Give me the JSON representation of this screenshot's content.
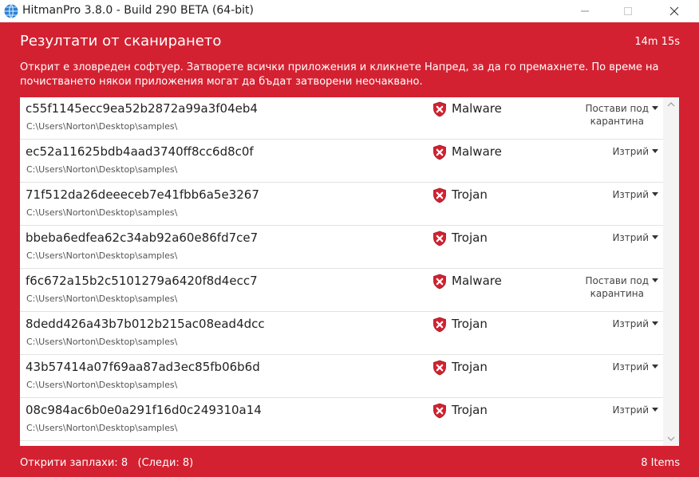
{
  "window": {
    "title": "HitmanPro 3.8.0 - Build 290 BETA (64-bit)"
  },
  "header": {
    "title": "Резултати от сканирането",
    "elapsed": "14m 15s",
    "message": "Открит е зловреден софтуер. Затворете всички приложения и кликнете Напред, за да го премахнете. По време на почистването някои приложения могат да бъдат затворени неочаквано."
  },
  "rows": [
    {
      "name": "c55f1145ecc9ea52b2872a99a3f04eb4",
      "path": "C:\\Users\\Norton\\Desktop\\samples\\",
      "type": "Malware",
      "action1": "Постави под",
      "action2": "карантина"
    },
    {
      "name": "ec52a11625bdb4aad3740ff8cc6d8c0f",
      "path": "C:\\Users\\Norton\\Desktop\\samples\\",
      "type": "Malware",
      "action1": "Изтрий",
      "action2": ""
    },
    {
      "name": "71f512da26deeeceb7e41fbb6a5e3267",
      "path": "C:\\Users\\Norton\\Desktop\\samples\\",
      "type": "Trojan",
      "action1": "Изтрий",
      "action2": ""
    },
    {
      "name": "bbeba6edfea62c34ab92a60e86fd7ce7",
      "path": "C:\\Users\\Norton\\Desktop\\samples\\",
      "type": "Trojan",
      "action1": "Изтрий",
      "action2": ""
    },
    {
      "name": "f6c672a15b2c5101279a6420f8d4ecc7",
      "path": "C:\\Users\\Norton\\Desktop\\samples\\",
      "type": "Malware",
      "action1": "Постави под",
      "action2": "карантина"
    },
    {
      "name": "8dedd426a43b7b012b215ac08ead4dcc",
      "path": "C:\\Users\\Norton\\Desktop\\samples\\",
      "type": "Trojan",
      "action1": "Изтрий",
      "action2": ""
    },
    {
      "name": "43b57414a07f69aa87ad3ec85fb06b6d",
      "path": "C:\\Users\\Norton\\Desktop\\samples\\",
      "type": "Trojan",
      "action1": "Изтрий",
      "action2": ""
    },
    {
      "name": "08c984ac6b0e0a291f16d0c249310a14",
      "path": "C:\\Users\\Norton\\Desktop\\samples\\",
      "type": "Trojan",
      "action1": "Изтрий",
      "action2": ""
    }
  ],
  "footer": {
    "threats": "Открити заплахи: 8",
    "traces": "(Следи: 8)",
    "items": "8 Items"
  },
  "colors": {
    "panel": "#d32131",
    "threat_icon": "#d32131"
  },
  "icons": {
    "app": "globe-icon",
    "threat": "shield-x-icon"
  }
}
